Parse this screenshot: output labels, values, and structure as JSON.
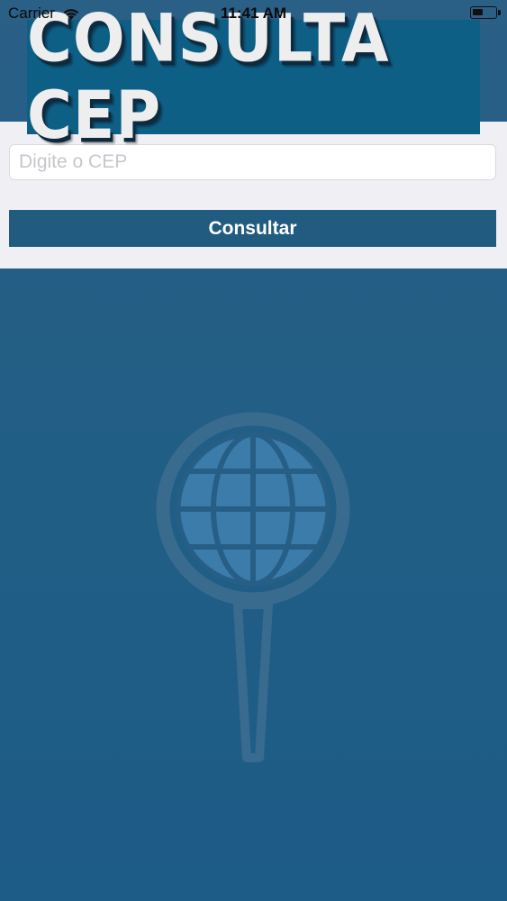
{
  "status_bar": {
    "carrier": "Carrier",
    "time": "11:41 AM"
  },
  "header": {
    "logo_text": "CONSULTA CEP"
  },
  "search": {
    "placeholder": "Digite o CEP",
    "value": "",
    "button_label": "Consultar"
  },
  "colors": {
    "background": "#215e85",
    "button": "#215b80",
    "logo_banner": "#0e5f86",
    "panel": "#efeff4"
  },
  "icons": {
    "wifi": "wifi-icon",
    "battery": "battery-icon",
    "background_art": "globe-pin-icon"
  }
}
